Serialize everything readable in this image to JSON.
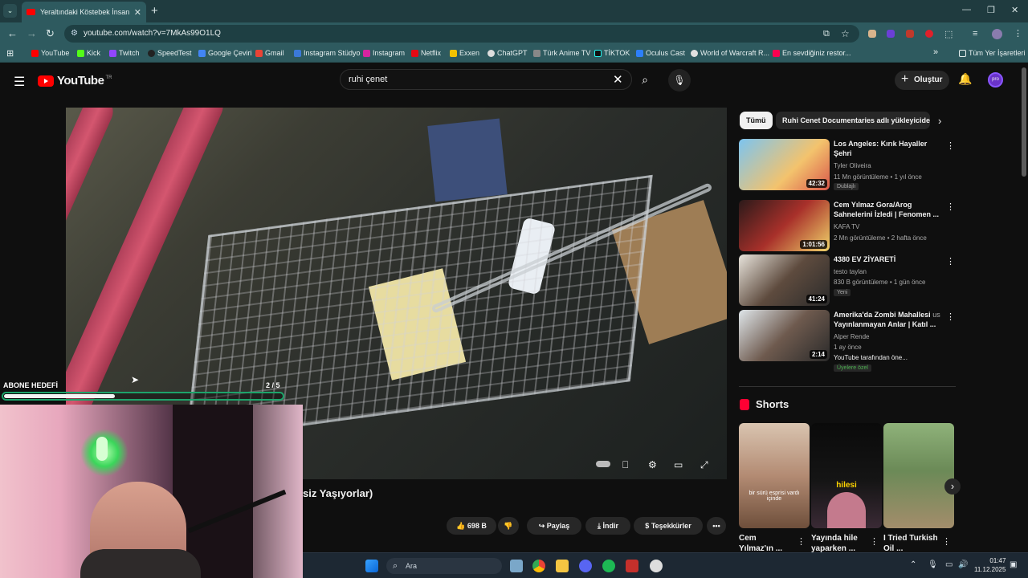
{
  "browser": {
    "tab_title": "Yeraltındaki Köstebek İnsanlar",
    "url": "youtube.com/watch?v=7MkAs99O1LQ",
    "bookmarks": [
      "YouTube",
      "Kick",
      "Twitch",
      "SpeedTest",
      "Google Çeviri",
      "Gmail",
      "Instagram Stüdyo",
      "Instagram",
      "Netflix",
      "Exxen",
      "ChatGPT",
      "Türk Anime TV",
      "TİKTOK",
      "Oculus Cast",
      "World of Warcraft R...",
      "En sevdiğiniz restor..."
    ],
    "bookmarks_more": "»",
    "all_bookmarks": "Tüm Yer İşaretleri"
  },
  "youtube": {
    "logo": "YouTube",
    "logo_region": "TR",
    "search_value": "ruhi çenet",
    "create_label": "Oluştur",
    "avatar_text": "pro"
  },
  "overlay": {
    "goal_label": "ABONE HEDEFİ",
    "goal_count": "2 / 5",
    "goal_progress": 0.4
  },
  "video": {
    "title_partial": "siz Yaşıyorlar)",
    "likes": "698 B",
    "share": "Paylaş",
    "download": "İndir",
    "thanks": "Teşekkürler"
  },
  "sidebar": {
    "chips": [
      "Tümü",
      "Ruhi Cenet Documentaries adlı yükleyiciden"
    ],
    "recommendations": [
      {
        "title": "Los Angeles: Kırık Hayaller Şehri",
        "channel": "Tyler Oliveira",
        "meta": "11 Mn görüntüleme • 1 yıl önce",
        "badge": "Dublajlı",
        "duration": "42:32"
      },
      {
        "title": "Cem Yılmaz Gora/Arog Sahnelerini İzledi | Fenomen ...",
        "channel": "KAFA TV",
        "meta": "2 Mn görüntüleme • 2 hafta önce",
        "badge": "",
        "duration": "1:01:56"
      },
      {
        "title": "4380 EV ZİYARETİ",
        "channel": "testo taylan",
        "meta": "830 B görüntüleme • 1 gün önce",
        "badge": "Yeni",
        "duration": "41:24"
      },
      {
        "title": "Amerika'da Zombi Mahallesi",
        "title_tag": "us",
        "title_line2": "Yayınlanmayan Anlar | Katıl ...",
        "channel": "Alper Rende",
        "meta": "1 ay önce",
        "meta2": "YouTube tarafından öne...",
        "badge": "Üyelere özel",
        "duration": "2:14"
      }
    ],
    "shorts_heading": "Shorts",
    "shorts": [
      {
        "title": "Cem Yılmaz'ın ...",
        "caption": "bir sürü esprisi vardı içinde"
      },
      {
        "title": "Yayında hile yaparken ...",
        "caption": "hilesi"
      },
      {
        "title": "I Tried Turkish Oil ...",
        "caption": ""
      }
    ]
  },
  "taskbar": {
    "search_placeholder": "Ara",
    "time": "01:47",
    "date": "11.12.2025"
  },
  "colors": {
    "yt_bg": "#0f0f0f",
    "browser_teal": "#2e5a5f",
    "yt_red": "#ff0000",
    "goal_green": "#1da36a"
  }
}
